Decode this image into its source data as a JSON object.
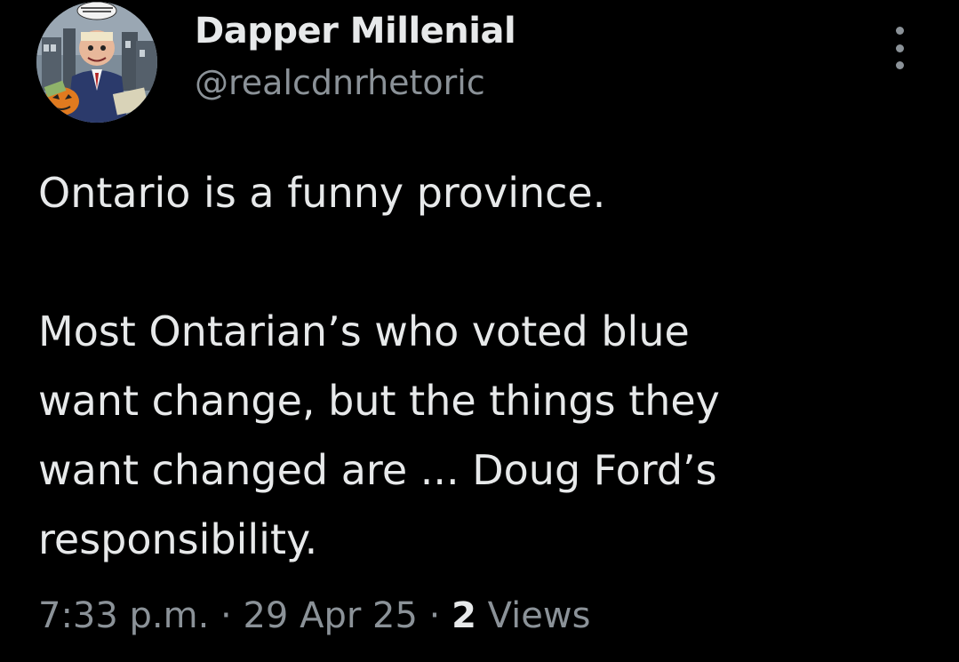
{
  "author": {
    "display_name": "Dapper Millenial",
    "handle": "@realcdnrhetoric",
    "avatar_icon": "cartoon-avatar-icon"
  },
  "menu": {
    "icon": "more-options-icon"
  },
  "tweet": {
    "line1": "Ontario is a funny province.",
    "line2": "Most Ontarian’s who voted blue",
    "line3": "want change, but the things they",
    "line4": "want changed are ... Doug Ford’s",
    "line5": "responsibility."
  },
  "meta": {
    "time": "7:33 p.m.",
    "separator": " · ",
    "date": "29 Apr 25",
    "views_count": "2",
    "views_label": "Views"
  },
  "colors": {
    "background": "#000000",
    "primary_text": "#e7e9ea",
    "secondary_text": "#8b9298"
  }
}
